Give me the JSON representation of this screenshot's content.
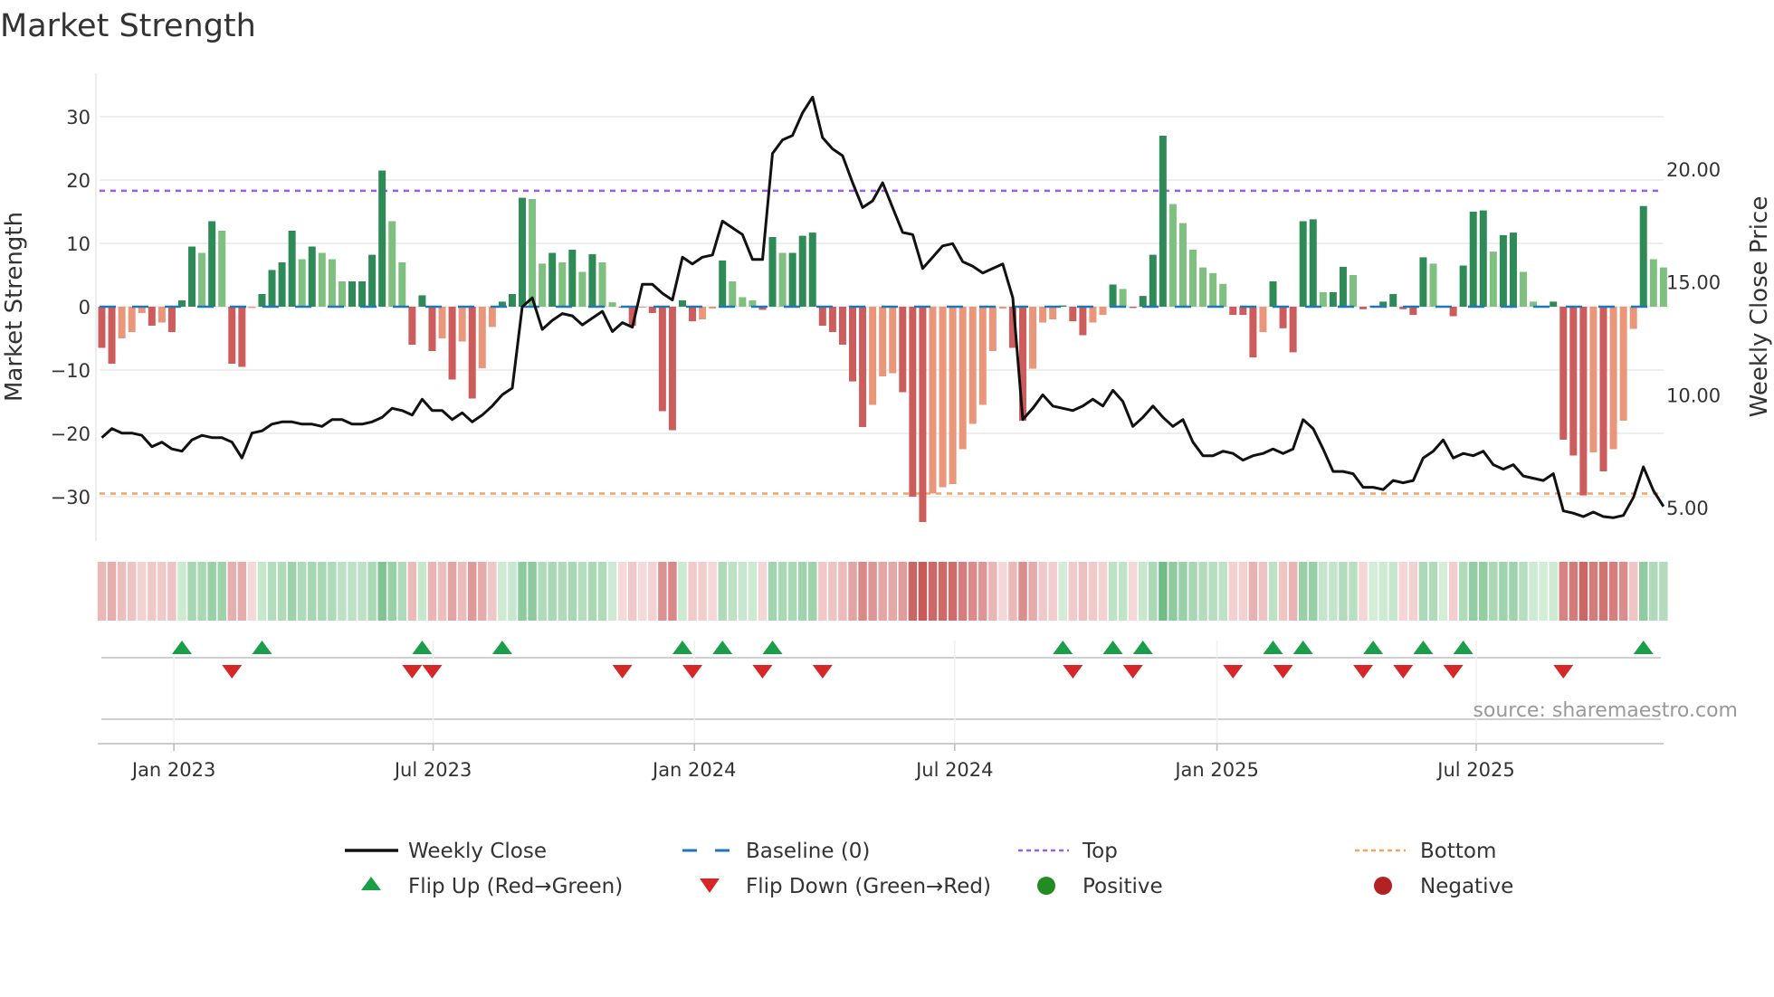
{
  "title": "Market Strength",
  "source": "source: sharemaestro.com",
  "chart_data": {
    "type": "bar+line",
    "title": "Market Strength",
    "ylabel": "Market Strength",
    "y2label": "Weekly Close Price",
    "ylim": [
      -37,
      38
    ],
    "y2lim": [
      3.9,
      24
    ],
    "yticks": [
      -30,
      -20,
      -10,
      0,
      10,
      20,
      30
    ],
    "ytick_labels": [
      "−30",
      "−20",
      "−10",
      "0",
      "10",
      "20",
      "30"
    ],
    "y2ticks": [
      5,
      10,
      15,
      20
    ],
    "y2tick_labels": [
      "5.00",
      "10.00",
      "15.00",
      "20.00"
    ],
    "xticks": [
      {
        "label": "Jan 2023",
        "index": 7.2
      },
      {
        "label": "Jul 2023",
        "index": 33.1
      },
      {
        "label": "Jan 2024",
        "index": 59.2
      },
      {
        "label": "Jul 2024",
        "index": 85.2
      },
      {
        "label": "Jan 2025",
        "index": 111.4
      },
      {
        "label": "Jul 2025",
        "index": 137.3
      }
    ],
    "top_level": 18.3,
    "bottom_level": -29.5,
    "baseline": 0,
    "strength": [
      -6.5,
      -9,
      -5,
      -4,
      -1,
      -3,
      -2.5,
      -4,
      1,
      9.5,
      8.5,
      13.5,
      12,
      -9,
      -9.5,
      -0.2,
      2,
      5.8,
      7,
      12,
      7.5,
      9.5,
      8.5,
      7.5,
      4,
      4,
      4,
      8.2,
      21.5,
      13.5,
      7,
      -6,
      1.8,
      -7,
      -5,
      -11.5,
      -5.5,
      -14.5,
      -9.7,
      -3.2,
      0.8,
      2,
      17.2,
      17,
      6.8,
      8.5,
      7,
      9,
      5.5,
      8.3,
      7,
      0.7,
      -0.1,
      -3,
      -0.1,
      -1,
      -16.5,
      -19.5,
      1,
      -2.3,
      -2,
      -0.3,
      7.3,
      4,
      1.5,
      1,
      -0.5,
      11,
      8.5,
      8.5,
      11.2,
      11.7,
      -3,
      -4,
      -6,
      -11.8,
      -19,
      -15.5,
      -11,
      -10.5,
      -13.5,
      -30,
      -34,
      -29.5,
      -28.5,
      -28,
      -22.5,
      -18.5,
      -15.5,
      -7,
      -0.3,
      -6.5,
      -18,
      -9.8,
      -2.5,
      -2,
      0.2,
      -2.3,
      -4.5,
      -2.5,
      -1.3,
      3.5,
      2.8,
      -0.2,
      1.7,
      8.2,
      27,
      16.2,
      13.2,
      9,
      6.2,
      5.3,
      3.6,
      -1.3,
      -1.3,
      -8,
      -4,
      4,
      -3.4,
      -7.2,
      13.5,
      13.8,
      2.3,
      2.3,
      6.3,
      5,
      -0.4,
      0.1,
      0.8,
      2,
      -0.4,
      -1.3,
      7.8,
      6.8,
      0.1,
      -1.5,
      6.5,
      15,
      15.2,
      8.7,
      11.3,
      11.7,
      5.5,
      0.8,
      0.1,
      0.8,
      -21,
      -23.5,
      -29.8,
      -23,
      -26,
      -22.5,
      -18,
      -3.5,
      15.9,
      7.5,
      6.2
    ],
    "weekly_close": [
      8.1,
      8.5,
      8.3,
      8.3,
      8.2,
      7.7,
      7.9,
      7.6,
      7.5,
      8.0,
      8.2,
      8.1,
      8.1,
      7.9,
      7.2,
      8.3,
      8.4,
      8.7,
      8.8,
      8.8,
      8.7,
      8.7,
      8.6,
      8.9,
      8.9,
      8.7,
      8.7,
      8.8,
      9.0,
      9.4,
      9.3,
      9.1,
      9.8,
      9.3,
      9.3,
      8.9,
      9.2,
      8.8,
      9.1,
      9.5,
      10.0,
      10.3,
      13.9,
      14.3,
      12.9,
      13.3,
      13.6,
      13.5,
      13.1,
      13.4,
      13.7,
      12.8,
      13.2,
      13.0,
      14.9,
      14.9,
      14.5,
      14.2,
      16.1,
      15.8,
      16.1,
      16.2,
      17.7,
      17.4,
      17.1,
      16.0,
      16.0,
      20.7,
      21.3,
      21.5,
      22.5,
      23.2,
      21.4,
      20.9,
      20.6,
      19.4,
      18.3,
      18.6,
      19.4,
      18.3,
      17.2,
      17.1,
      15.6,
      16.1,
      16.6,
      16.7,
      15.9,
      15.7,
      15.4,
      15.6,
      15.8,
      14.3,
      8.9,
      9.4,
      10.0,
      9.5,
      9.4,
      9.3,
      9.5,
      9.8,
      9.5,
      10.2,
      9.7,
      8.6,
      9.0,
      9.5,
      9.0,
      8.6,
      8.9,
      7.9,
      7.3,
      7.3,
      7.5,
      7.4,
      7.1,
      7.3,
      7.4,
      7.6,
      7.4,
      7.6,
      8.9,
      8.5,
      7.6,
      6.6,
      6.6,
      6.5,
      5.9,
      5.9,
      5.8,
      6.2,
      6.1,
      6.2,
      7.2,
      7.5,
      8.0,
      7.2,
      7.4,
      7.3,
      7.5,
      6.9,
      6.7,
      6.9,
      6.4,
      6.3,
      6.2,
      6.5,
      4.85,
      4.75,
      4.6,
      4.8,
      4.6,
      4.55,
      4.65,
      5.45,
      6.8,
      5.75,
      5.05
    ],
    "colors": {
      "pos_strong": "#2e8b57",
      "pos_weak": "#7fbf7f",
      "neg_strong": "#cd5c5c",
      "neg_weak": "#e9967a",
      "line": "#111111",
      "baseline": "#1f77b4",
      "top": "#9b5de5",
      "bottom": "#f4a261",
      "flip_up": "#1a9e4a",
      "flip_down": "#d62728",
      "positive": "#228b22",
      "negative": "#b22222"
    },
    "legend": {
      "placement": "bottom",
      "items": [
        {
          "label": "Weekly Close",
          "symbol": "line"
        },
        {
          "label": "Baseline (0)",
          "symbol": "dash"
        },
        {
          "label": "Top",
          "symbol": "dot-purple"
        },
        {
          "label": "Bottom",
          "symbol": "dot-orange"
        },
        {
          "label": "Flip Up (Red→Green)",
          "symbol": "triangle-up"
        },
        {
          "label": "Flip Down (Green→Red)",
          "symbol": "triangle-down"
        },
        {
          "label": "Positive",
          "symbol": "circle-green"
        },
        {
          "label": "Negative",
          "symbol": "circle-red"
        }
      ]
    }
  }
}
